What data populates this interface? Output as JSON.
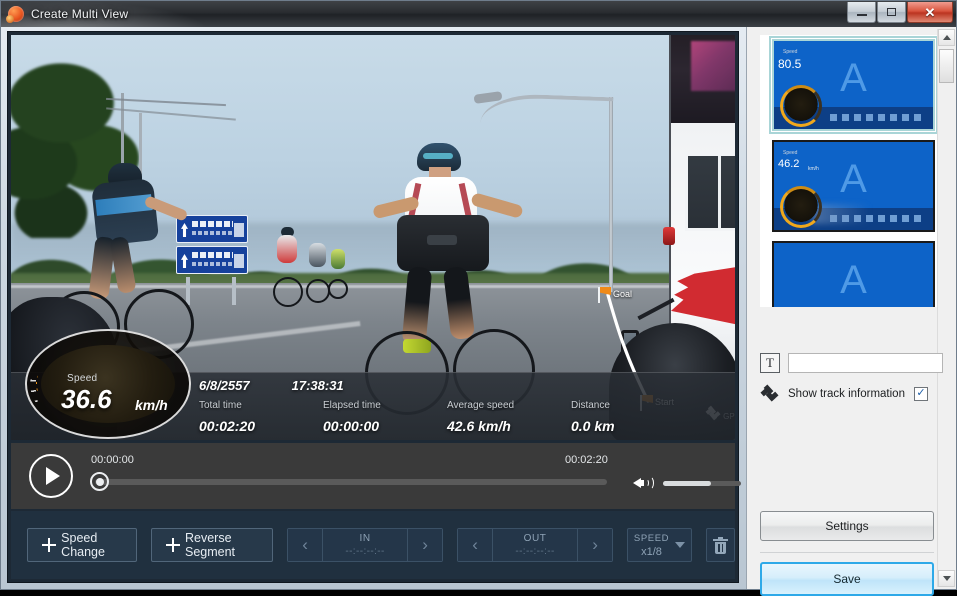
{
  "window": {
    "title": "Create Multi View",
    "app_icon": "app-logo-icon",
    "buttons": {
      "minimize": "minimize-icon",
      "maximize": "maximize-icon",
      "close": "close-icon"
    }
  },
  "video": {
    "gps_overlay": {
      "goal_label": "Goal",
      "start_label": "Start",
      "gps_label": "GPS"
    },
    "telemetry": {
      "date": "6/8/2557",
      "clock": "17:38:31",
      "speed_label": "Speed",
      "speed_value": "36.6",
      "speed_unit": "km/h",
      "fields": [
        {
          "key": "Total time",
          "value": "00:02:20"
        },
        {
          "key": "Elapsed time",
          "value": "00:00:00"
        },
        {
          "key": "Average speed",
          "value": "42.6 km/h"
        },
        {
          "key": "Distance",
          "value": "0.0 km"
        }
      ]
    }
  },
  "transport": {
    "play_icon": "play-icon",
    "current_time": "00:00:00",
    "total_time": "00:02:20",
    "volume_icon": "volume-icon",
    "volume_percent": 62,
    "progress_percent": 0
  },
  "toolbar": {
    "speed_change": "Speed Change",
    "reverse_segment": "Reverse Segment",
    "in": {
      "label": "IN",
      "value": "--:--:--:--",
      "prev_icon": "chevron-left-icon",
      "next_icon": "chevron-right-icon"
    },
    "out": {
      "label": "OUT",
      "value": "--:--:--:--",
      "prev_icon": "chevron-left-icon",
      "next_icon": "chevron-right-icon"
    },
    "speed": {
      "label": "SPEED",
      "value": "x1/8",
      "chevron_icon": "chevron-down-icon"
    },
    "delete_icon": "trash-icon"
  },
  "right_panel": {
    "templates": [
      {
        "letter": "A",
        "speed": "80.5",
        "unit": "",
        "selected": true
      },
      {
        "letter": "A",
        "speed": "46.2",
        "unit": "km/h",
        "selected": false
      },
      {
        "letter": "A",
        "speed": "",
        "unit": "",
        "selected": false
      }
    ],
    "scrollbar": {
      "up_icon": "scroll-up-icon",
      "down_icon": "scroll-down-icon"
    },
    "text_tool": {
      "button_label": "T",
      "input_value": "",
      "input_placeholder": ""
    },
    "track_info": {
      "icon": "satellite-icon",
      "label": "Show track information",
      "checked": true,
      "check_glyph": "✓"
    },
    "settings_button": "Settings",
    "save_button": "Save"
  },
  "colors": {
    "accent_blue": "#0d63c8",
    "save_border": "#2ea9e8",
    "toolbar_bg": "#20303f",
    "gauge_orange": "#f59a1a"
  }
}
